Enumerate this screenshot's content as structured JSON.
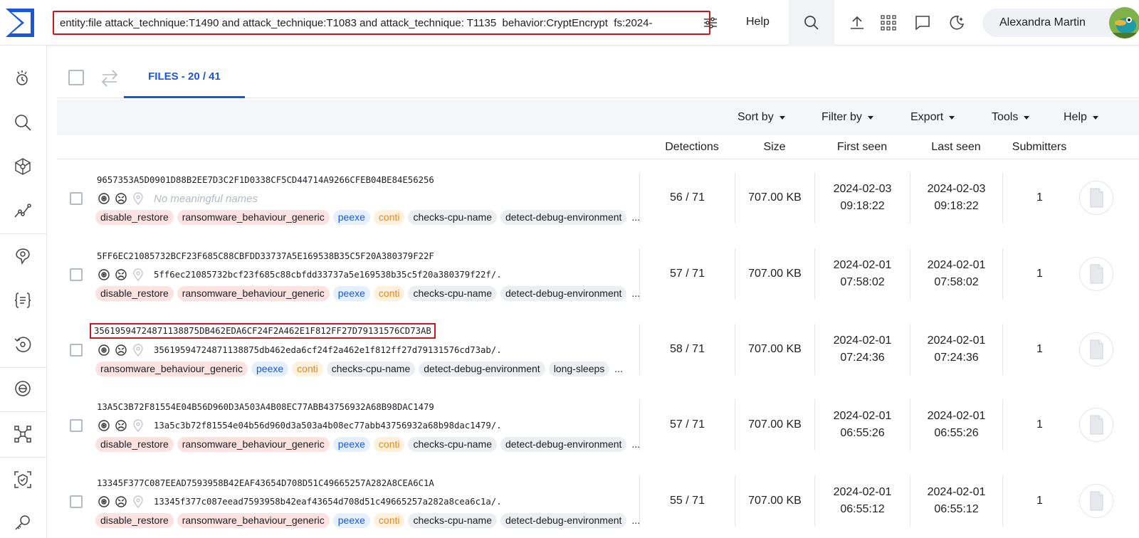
{
  "topbar": {
    "search_query": "entity:file attack_technique:T1490 and attack_technique:T1083 and attack_technique: T1135  behavior:CryptEncrypt  fs:2024-",
    "help_label": "Help",
    "user_name": "Alexandra Martin",
    "icons": [
      "logo-sigma",
      "sliders-icon",
      "search-icon",
      "upload-icon",
      "apps-grid-icon",
      "chat-icon",
      "dark-mode-icon"
    ]
  },
  "sidebar": {
    "icons": [
      "threat-landscape-icon",
      "search-icon",
      "graph-icon",
      "hunting-icon",
      "intelligence-icon",
      "code-rules-icon",
      "retrohunt-icon",
      "collections-icon",
      "sandbox-icon",
      "shield-icon",
      "key-icon"
    ]
  },
  "tabs": {
    "files_label": "FILES - 20 / 41"
  },
  "toolbar": {
    "sort_label": "Sort by",
    "filter_label": "Filter by",
    "export_label": "Export",
    "tools_label": "Tools",
    "help_label": "Help"
  },
  "columns": {
    "detections": "Detections",
    "size": "Size",
    "first_seen": "First seen",
    "last_seen": "Last seen",
    "submitters": "Submitters"
  },
  "rows": [
    {
      "hash": "9657353A5D0901D88B2EE7D3C2F1D0338CF5CD44714A9266CFEB04BE84E56256",
      "name": "No meaningful names",
      "tags": [
        "disable_restore",
        "ransomware_behaviour_generic",
        "peexe",
        "conti",
        "checks-cpu-name",
        "detect-debug-environment"
      ],
      "detections": "56 / 71",
      "size": "707.00 KB",
      "first_seen_date": "2024-02-03",
      "first_seen_time": "09:18:22",
      "last_seen_date": "2024-02-03",
      "last_seen_time": "09:18:22",
      "submitters": "1"
    },
    {
      "hash": "5FF6EC21085732BCF23F685C88CBFDD33737A5E169538B35C5F20A380379F22F",
      "name": "5ff6ec21085732bcf23f685c88cbfdd33737a5e169538b35c5f20a380379f22f/.",
      "tags": [
        "disable_restore",
        "ransomware_behaviour_generic",
        "peexe",
        "conti",
        "checks-cpu-name",
        "detect-debug-environment"
      ],
      "detections": "57 / 71",
      "size": "707.00 KB",
      "first_seen_date": "2024-02-01",
      "first_seen_time": "07:58:02",
      "last_seen_date": "2024-02-01",
      "last_seen_time": "07:58:02",
      "submitters": "1"
    },
    {
      "hash": "35619594724871138875DB462EDA6CF24F2A462E1F812FF27D79131576CD73AB",
      "name": "35619594724871138875db462eda6cf24f2a462e1f812ff27d79131576cd73ab/.",
      "tags": [
        "ransomware_behaviour_generic",
        "peexe",
        "conti",
        "checks-cpu-name",
        "detect-debug-environment",
        "long-sleeps"
      ],
      "detections": "58 / 71",
      "size": "707.00 KB",
      "first_seen_date": "2024-02-01",
      "first_seen_time": "07:24:36",
      "last_seen_date": "2024-02-01",
      "last_seen_time": "07:24:36",
      "submitters": "1"
    },
    {
      "hash": "13A5C3B72F81554E04B56D960D3A503A4B08EC77ABB43756932A68B98DAC1479",
      "name": "13a5c3b72f81554e04b56d960d3a503a4b08ec77abb43756932a68b98dac1479/.",
      "tags": [
        "disable_restore",
        "ransomware_behaviour_generic",
        "peexe",
        "conti",
        "checks-cpu-name",
        "detect-debug-environment"
      ],
      "detections": "57 / 71",
      "size": "707.00 KB",
      "first_seen_date": "2024-02-01",
      "first_seen_time": "06:55:26",
      "last_seen_date": "2024-02-01",
      "last_seen_time": "06:55:26",
      "submitters": "1"
    },
    {
      "hash": "13345F377C087EEAD7593958B42EAF43654D708D51C49665257A282A8CEA6C1A",
      "name": "13345f377c087eead7593958b42eaf43654d708d51c49665257a282a8cea6c1a/.",
      "tags": [
        "disable_restore",
        "ransomware_behaviour_generic",
        "peexe",
        "conti",
        "checks-cpu-name",
        "detect-debug-environment"
      ],
      "detections": "55 / 71",
      "size": "707.00 KB",
      "first_seen_date": "2024-02-01",
      "first_seen_time": "06:55:12",
      "last_seen_date": "2024-02-01",
      "last_seen_time": "06:55:12",
      "submitters": "1"
    }
  ],
  "ellipsis": "...",
  "colors": {
    "accent": "#1a56db",
    "highlight_box": "#c8161d",
    "tag_red_bg": "#fde2e2",
    "tag_blue_bg": "#e4efff",
    "tag_orange_text": "#e8871e",
    "tag_gray_bg": "#eceef2"
  }
}
